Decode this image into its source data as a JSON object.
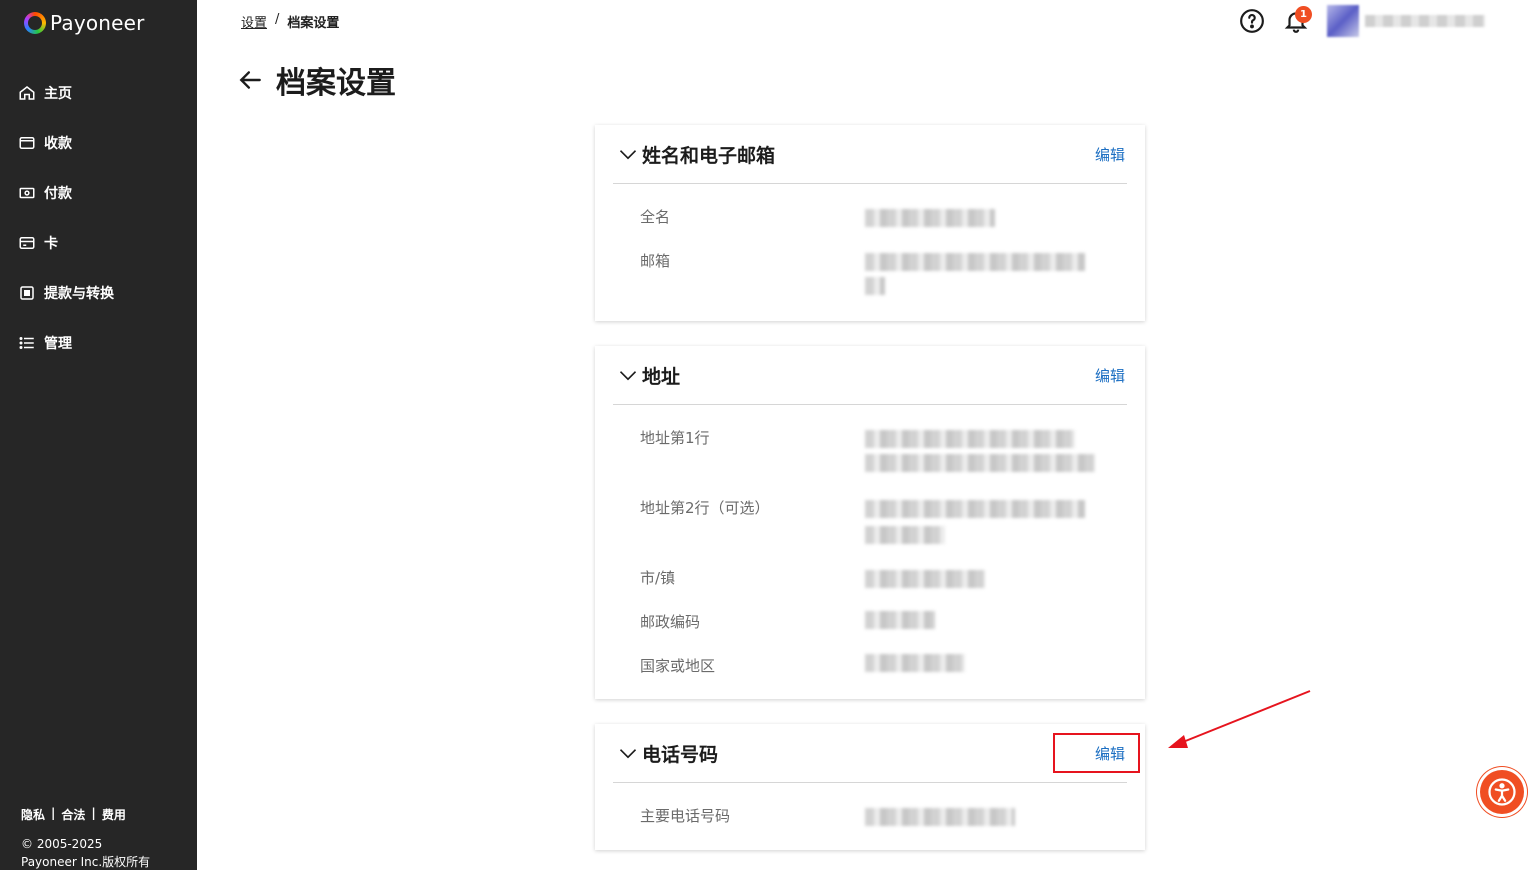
{
  "brand": {
    "name": "Payoneer"
  },
  "sidebar": {
    "items": [
      {
        "label": "主页",
        "icon": "home-icon"
      },
      {
        "label": "收款",
        "icon": "wallet-icon"
      },
      {
        "label": "付款",
        "icon": "payment-icon"
      },
      {
        "label": "卡",
        "icon": "card-icon"
      },
      {
        "label": "提款与转换",
        "icon": "withdraw-icon"
      },
      {
        "label": "管理",
        "icon": "list-icon"
      }
    ],
    "footer_links": [
      "隐私",
      "合法",
      "费用"
    ],
    "copyright_line1": "© 2005-2025",
    "copyright_line2": "Payoneer Inc.版权所有"
  },
  "breadcrumb": {
    "parent": "设置",
    "separator": "/",
    "current": "档案设置"
  },
  "page": {
    "title": "档案设置"
  },
  "topbar": {
    "notification_count": "1"
  },
  "sections": {
    "name_email": {
      "title": "姓名和电子邮箱",
      "edit_label": "编辑",
      "fields": [
        "全名",
        "邮箱"
      ]
    },
    "address": {
      "title": "地址",
      "edit_label": "编辑",
      "fields": [
        "地址第1行",
        "地址第2行（可选）",
        "市/镇",
        "邮政编码",
        "国家或地区"
      ]
    },
    "phone": {
      "title": "电话号码",
      "edit_label": "编辑",
      "fields": [
        "主要电话号码"
      ]
    }
  },
  "colors": {
    "sidebar_bg": "#262626",
    "link": "#1b6ec2",
    "accent": "#f04e23",
    "highlight": "#e6141e"
  }
}
